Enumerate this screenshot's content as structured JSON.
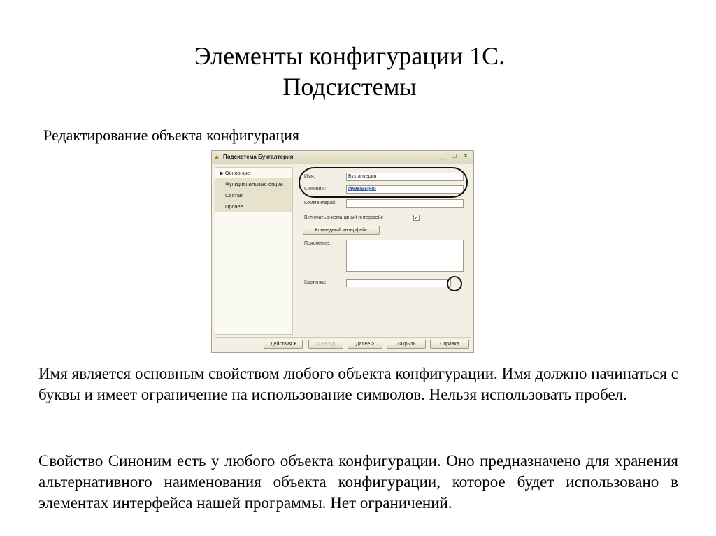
{
  "slide": {
    "title_line1": "Элементы конфигурации 1С.",
    "title_line2": "Подсистемы",
    "subtitle": "Редактирование объекта конфигурация",
    "paragraph1": "Имя является основным свойством любого объекта конфигурации. Имя должно начинаться с буквы и имеет ограничение на использование символов. Нельзя использовать пробел.",
    "paragraph2": "Свойство Синоним есть у любого объекта конфигурации. Оно предназначено для хранения альтернативного наименования объекта конфигурации, которое будет использовано в элементах интерфейса нашей программы. Нет ограничений."
  },
  "dialog": {
    "title": "Подсистема Бухгалтерия",
    "window_controls": "_ □ ×",
    "sidebar": [
      {
        "label": "Основные",
        "selected": true
      },
      {
        "label": "Функциональные опции",
        "selected": false
      },
      {
        "label": "Состав",
        "selected": false
      },
      {
        "label": "Прочее",
        "selected": false
      }
    ],
    "fields": {
      "name_label": "Имя:",
      "name_value": "Бухгалтерия",
      "synonym_label": "Синоним:",
      "synonym_value": "Бухгалтерия",
      "comment_label": "Комментарий:",
      "include_label": "Включать в командный интерфейс",
      "include_checked": true,
      "command_interface_button": "Командный интерфейс",
      "explanation_label": "Пояснение:",
      "picture_label": "Картинка:"
    },
    "buttons": {
      "actions": "Действия ▾",
      "back": "< Назад",
      "next": "Далее >",
      "close": "Закрыть",
      "help": "Справка"
    }
  }
}
